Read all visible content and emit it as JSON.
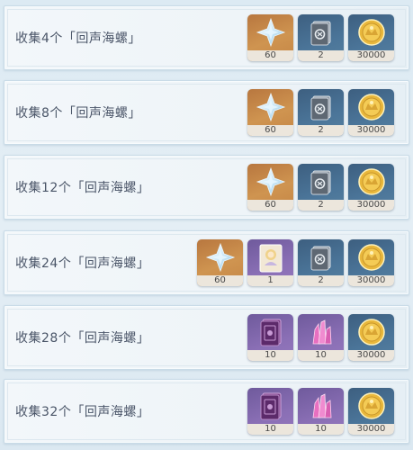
{
  "rows": [
    {
      "label": "收集4个「回声海螺」",
      "rewards": [
        {
          "icon": "primogem",
          "count": "60"
        },
        {
          "icon": "hero-wit-book",
          "count": "2"
        },
        {
          "icon": "mora",
          "count": "30000"
        }
      ]
    },
    {
      "label": "收集8个「回声海螺」",
      "rewards": [
        {
          "icon": "primogem",
          "count": "60"
        },
        {
          "icon": "hero-wit-book",
          "count": "2"
        },
        {
          "icon": "mora",
          "count": "30000"
        }
      ]
    },
    {
      "label": "收集12个「回声海螺」",
      "rewards": [
        {
          "icon": "primogem",
          "count": "60"
        },
        {
          "icon": "hero-wit-book",
          "count": "2"
        },
        {
          "icon": "mora",
          "count": "30000"
        }
      ]
    },
    {
      "label": "收集24个「回声海螺」",
      "rewards": [
        {
          "icon": "primogem",
          "count": "60"
        },
        {
          "icon": "namecard",
          "count": "1"
        },
        {
          "icon": "hero-wit-book",
          "count": "2"
        },
        {
          "icon": "mora",
          "count": "30000"
        }
      ]
    },
    {
      "label": "收集28个「回声海螺」",
      "rewards": [
        {
          "icon": "purple-book",
          "count": "10"
        },
        {
          "icon": "crystal",
          "count": "10"
        },
        {
          "icon": "mora",
          "count": "30000"
        }
      ]
    },
    {
      "label": "收集32个「回声海螺」",
      "rewards": [
        {
          "icon": "purple-book",
          "count": "10"
        },
        {
          "icon": "crystal",
          "count": "10"
        },
        {
          "icon": "mora",
          "count": "30000"
        }
      ]
    }
  ],
  "colors": {
    "orange_bg": "#c58645",
    "blue_bg": "#4b7599",
    "purple_bg": "#8a6fb5",
    "label_text": "#4a5568"
  }
}
